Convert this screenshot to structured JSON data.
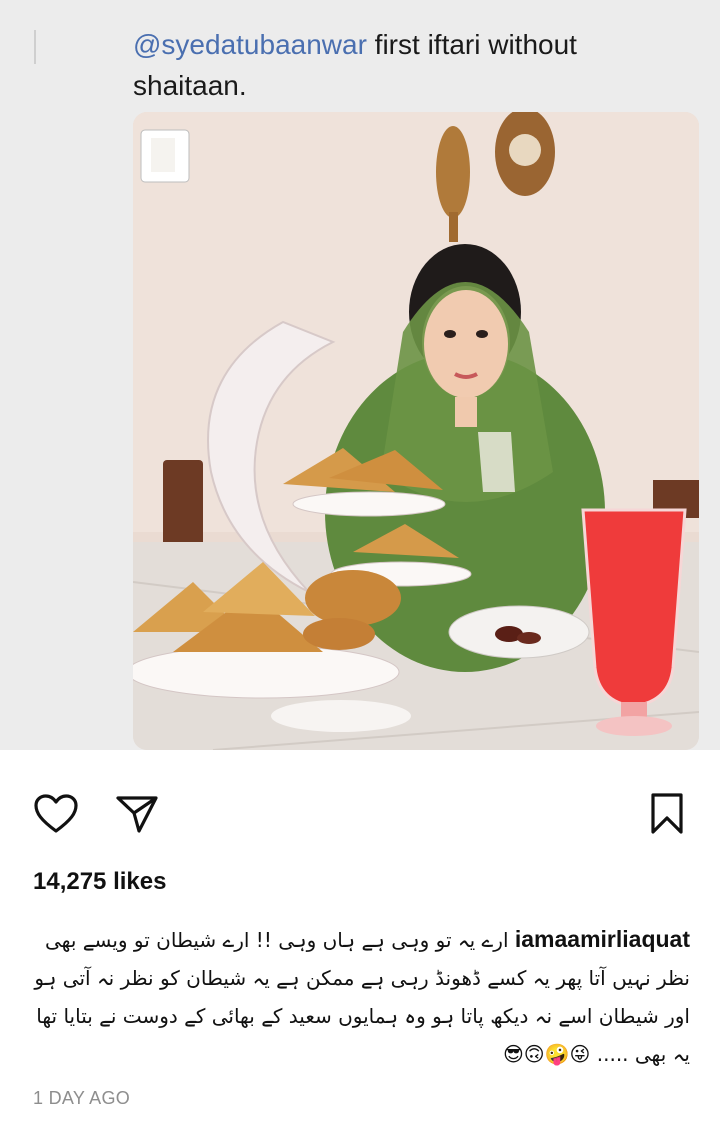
{
  "post": {
    "caption_handle": "@syedatubaanwar",
    "caption_text": " first iftari without shaitaan.",
    "likes": "14,275 likes",
    "comment_user": "iamaamirliaquat",
    "comment_text": "ارے یہ تو وہی ہے ہاں وہی !! ارے شیطان تو ویسے بھی نظر نہیں آتا پھر یہ کسے ڈھونڈ رہی ہے ممکن ہے یہ شیطان کو نظر نہ آتی ہو اور شیطان اسے نہ دیکھ پاتا ہو وہ ہمایوں سعید کے بھائی کے دوست نے بتایا تھا یہ بھی ..... 😜🤪🙃😎",
    "timestamp": "1 DAY AGO"
  },
  "icons": [
    "heart-icon",
    "share-icon",
    "bookmark-icon"
  ],
  "colors": {
    "handle": "#4a6fb0",
    "timestamp": "#8e8e8e",
    "shawl": "#5f8a3e",
    "drink": "#ef3b3b"
  }
}
